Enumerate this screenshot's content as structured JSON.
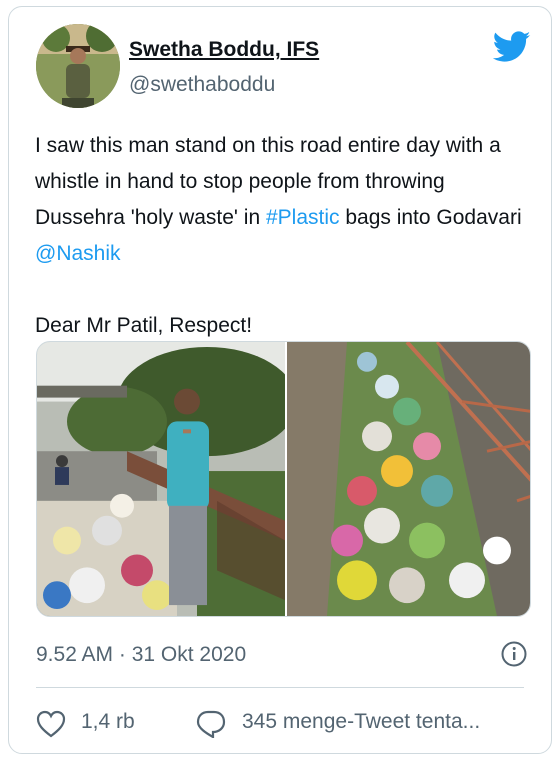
{
  "author": {
    "name": "Swetha Boddu, IFS",
    "handle": "@swethaboddu"
  },
  "tweet": {
    "line1": "I saw this man stand on this road entire day with a whistle in hand to stop people from throwing Dussehra 'holy waste' in ",
    "hashtag": "#Plastic",
    "line2": " bags into Godavari ",
    "mention": "@Nashik",
    "line3": "Dear Mr Patil, Respect!"
  },
  "meta": {
    "timestamp": "9.52 AM · 31 Okt 2020"
  },
  "actions": {
    "likes": "1,4 rb",
    "replies": "345 menge-Tweet tenta..."
  },
  "colors": {
    "accent": "#1d9bf0",
    "text": "#0f1419",
    "secondary": "#536471",
    "border": "#cfd9de"
  },
  "icons": [
    "twitter-bird-icon",
    "info-icon",
    "heart-icon",
    "reply-icon"
  ]
}
